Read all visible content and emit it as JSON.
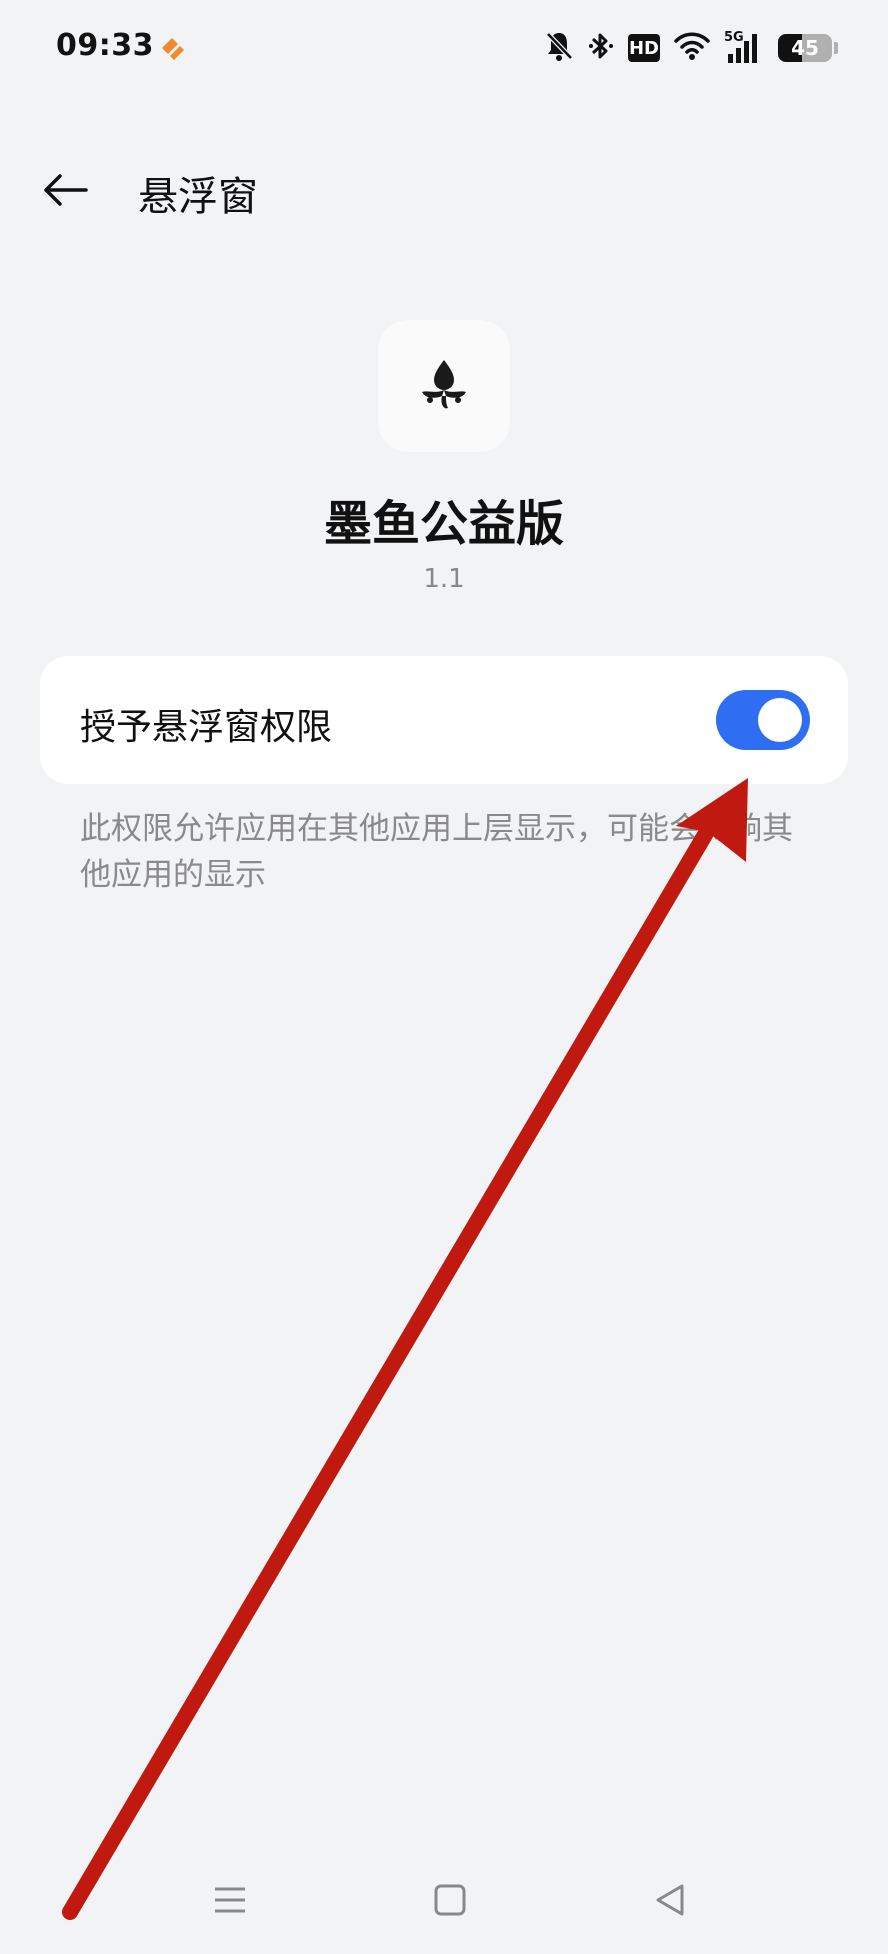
{
  "status_bar": {
    "time": "09:33",
    "hd_label": "HD",
    "signal_label": "5G",
    "battery_level": "45",
    "icons": [
      "notification-off-icon",
      "bluetooth-icon",
      "hd-icon",
      "wifi-icon",
      "cellular-5g-icon",
      "battery-icon"
    ]
  },
  "header": {
    "title": "悬浮窗",
    "back_icon": "back-arrow-icon"
  },
  "app": {
    "name": "墨鱼公益版",
    "version": "1.1",
    "icon": "app-logo-icon"
  },
  "permission": {
    "label": "授予悬浮窗权限",
    "enabled": true,
    "description": "此权限允许应用在其他应用上层显示，可能会影响其他应用的显示"
  },
  "nav_bar": {
    "icons": [
      "menu-icon",
      "home-icon",
      "back-triangle-icon"
    ]
  },
  "colors": {
    "background": "#f2f3f5",
    "card": "#ffffff",
    "accent": "#2f6df2",
    "secondary_text": "#8a8a8a",
    "annotation_arrow": "#c0190f"
  }
}
